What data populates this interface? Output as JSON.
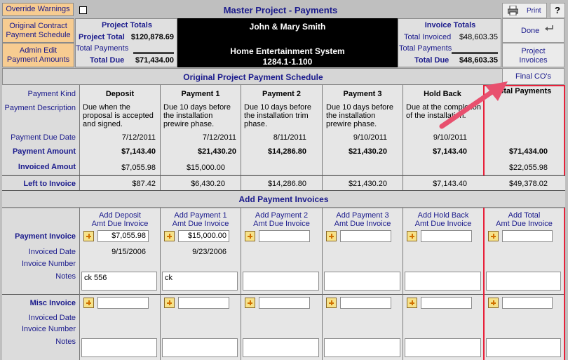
{
  "top": {
    "override_warnings": "Override Warnings",
    "title": "Master Project - Payments",
    "print": "Print",
    "help": "?",
    "orig_contract_btn": "Original Contract\nPayment Schedule",
    "admin_edit_btn": "Admin Edit\nPayment Amounts",
    "done": "Done",
    "project_invoices": "Project\nInvoices",
    "final_cos": "Final CO's"
  },
  "project_totals": {
    "title": "Project Totals",
    "project_total_label": "Project Total",
    "project_total": "$120,878.69",
    "total_payments_label": "Total Payments",
    "total_payments": "",
    "total_due_label": "Total Due",
    "total_due": "$71,434.00"
  },
  "client": {
    "name": "John & Mary Smith",
    "project": "Home Entertainment System",
    "code": "1284.1-1.100"
  },
  "invoice_totals": {
    "title": "Invoice Totals",
    "total_invoiced_label": "Total Invoiced",
    "total_invoiced": "$48,603.35",
    "total_payments_label": "Total Payments",
    "total_payments": "",
    "total_due_label": "Total Due",
    "total_due": "$48,603.35"
  },
  "schedule": {
    "section_title": "Original Project Payment Schedule",
    "row_labels": {
      "kind": "Payment Kind",
      "desc": "Payment Description",
      "due": "Payment Due Date",
      "amount": "Payment Amount",
      "invoiced": "Invoiced Amout",
      "left": "Left to Invoice"
    },
    "columns": [
      {
        "kind": "Deposit",
        "desc": "Due when the proposal is accepted and signed.",
        "due": "7/12/2011",
        "amount": "$7,143.40",
        "invoiced": "$7,055.98",
        "left": "$87.42"
      },
      {
        "kind": "Payment 1",
        "desc": "Due 10 days before the installation prewire phase.",
        "due": "7/12/2011",
        "amount": "$21,430.20",
        "invoiced": "$15,000.00",
        "left": "$6,430.20"
      },
      {
        "kind": "Payment 2",
        "desc": "Due 10 days before the installation trim phase.",
        "due": "8/11/2011",
        "amount": "$14,286.80",
        "invoiced": "",
        "left": "$14,286.80"
      },
      {
        "kind": "Payment 3",
        "desc": "Due 10 days before the installation prewire phase.",
        "due": "9/10/2011",
        "amount": "$21,430.20",
        "invoiced": "",
        "left": "$21,430.20"
      },
      {
        "kind": "Hold Back",
        "desc": "Due at the completion of the installation.",
        "due": "9/10/2011",
        "amount": "$7,143.40",
        "invoiced": "",
        "left": "$7,143.40"
      }
    ],
    "total": {
      "kind": "Total Payments",
      "amount": "$71,434.00",
      "invoiced": "$22,055.98",
      "left": "$49,378.02"
    }
  },
  "invoices": {
    "section_title": "Add Payment Invoices",
    "labels": {
      "payment_invoice": "Payment Invoice",
      "invoiced_date": "Invoiced Date",
      "invoice_number": "Invoice Number",
      "notes": "Notes",
      "misc_invoice": "Misc Invoice"
    },
    "columns": [
      {
        "head": "Add Deposit\nAmt Due Invoice",
        "amount": "$7,055.98",
        "date": "9/15/2006",
        "note": "ck 556"
      },
      {
        "head": "Add Payment 1\nAmt Due Invoice",
        "amount": "$15,000.00",
        "date": "9/23/2006",
        "note": "ck"
      },
      {
        "head": "Add Payment 2\nAmt Due Invoice",
        "amount": "",
        "date": "",
        "note": ""
      },
      {
        "head": "Add Payment 3\nAmt Due Invoice",
        "amount": "",
        "date": "",
        "note": ""
      },
      {
        "head": "Add Hold Back\nAmt Due Invoice",
        "amount": "",
        "date": "",
        "note": ""
      },
      {
        "head": "Add Total\nAmt Due Invoice",
        "amount": "",
        "date": "",
        "note": ""
      }
    ]
  },
  "colors": {
    "accent_red": "#e8203a",
    "arrow": "#e8506e",
    "header_black": "#000000",
    "button_orange": "#f7cc91"
  }
}
